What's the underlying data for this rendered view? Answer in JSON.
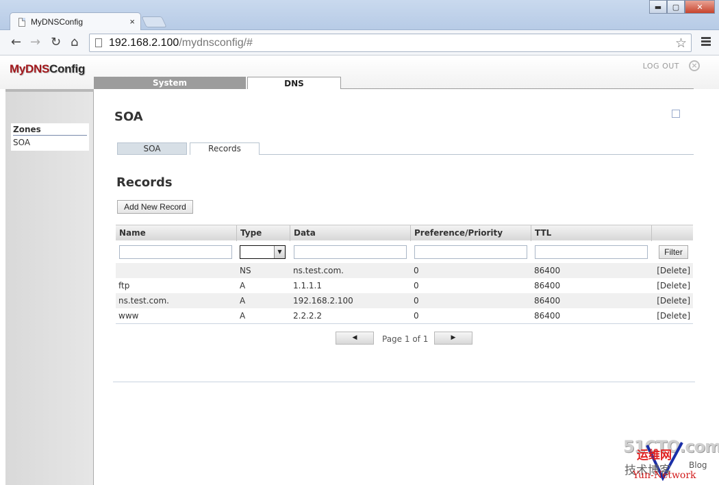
{
  "browser": {
    "tab_title": "MyDNSConfig",
    "tab_close": "×",
    "window_buttons": {
      "minimize": "▬",
      "maximize": "▢",
      "close": "✕"
    },
    "nav": {
      "back": "←",
      "forward": "→",
      "reload": "↻",
      "home": "⌂"
    },
    "url_host": "192.168.2.100",
    "url_path": "/mydnsconfig/#",
    "bookmark_star": "☆"
  },
  "app": {
    "logo_part1": "MyDNS",
    "logo_part2": "Config",
    "logout_label": "LOG OUT",
    "logout_glyph": "×",
    "main_tabs": [
      {
        "label": "System"
      },
      {
        "label": "DNS"
      }
    ],
    "sidebar": {
      "heading": "Zones",
      "items": [
        {
          "label": "SOA"
        }
      ]
    },
    "content": {
      "title": "SOA",
      "sub_tabs": [
        {
          "label": "SOA"
        },
        {
          "label": "Records"
        }
      ],
      "section_title": "Records",
      "add_button": "Add New Record",
      "columns": [
        "Name",
        "Type",
        "Data",
        "Preference/Priority",
        "TTL",
        ""
      ],
      "filter_button": "Filter",
      "rows": [
        {
          "name": "",
          "type": "NS",
          "data": "ns.test.com.",
          "pref": "0",
          "ttl": "86400",
          "action": "[Delete]"
        },
        {
          "name": "ftp",
          "type": "A",
          "data": "1.1.1.1",
          "pref": "0",
          "ttl": "86400",
          "action": "[Delete]"
        },
        {
          "name": "ns.test.com.",
          "type": "A",
          "data": "192.168.2.100",
          "pref": "0",
          "ttl": "86400",
          "action": "[Delete]"
        },
        {
          "name": "www",
          "type": "A",
          "data": "2.2.2.2",
          "pref": "0",
          "ttl": "86400",
          "action": "[Delete]"
        }
      ],
      "pager": {
        "prev": "◀",
        "next": "▶",
        "text": "Page 1 of 1"
      }
    }
  },
  "watermark": {
    "big": "51CTO.com",
    "cn1": "运维网",
    "cn2": "技术博客",
    "blog": "Blog",
    "yun": "Yun-Network"
  },
  "colors": {
    "logo_red": "#a2181c",
    "tab_grey": "#9c9c9c",
    "window_close": "#c7442d"
  }
}
